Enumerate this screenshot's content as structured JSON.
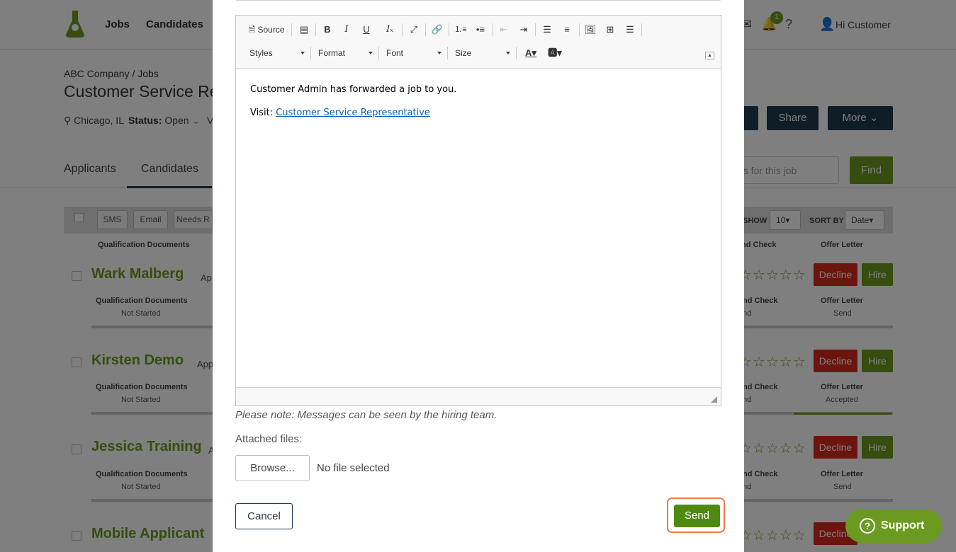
{
  "nav": {
    "jobs": "Jobs",
    "candidates": "Candidates",
    "greeting": "Hi Customer",
    "notification_count": "1"
  },
  "job": {
    "breadcrumb": "ABC Company / Jobs",
    "title": "Customer Service Re",
    "location": "Chicago, IL",
    "status_label": "Status:",
    "status_value": "Open",
    "meta_truncated": "V",
    "share_label": "Share",
    "more_label": "More"
  },
  "tabs": {
    "applicants": "Applicants",
    "candidates": "Candidates"
  },
  "search": {
    "placeholder": "es for this job",
    "find_label": "Find"
  },
  "list_toolbar": {
    "sms": "SMS",
    "email": "Email",
    "needs": "Needs R",
    "show_label": "SHOW",
    "show_value": "10",
    "sort_label": "SORT BY",
    "sort_value": "Date"
  },
  "columns": {
    "qualification": "Qualification Documents",
    "background": "nd Check",
    "offer": "Offer Letter"
  },
  "candidates": [
    {
      "name": "Wark Malberg",
      "app": "Ap",
      "qual_label": "Qualification Documents",
      "qual_value": "Not Started",
      "bg_label": "nd Check",
      "bg_value": "nd",
      "offer_label": "Offer Letter",
      "offer_value": "Send",
      "decline": "Decline",
      "hire": "Hire",
      "stars": "☆☆☆☆☆"
    },
    {
      "name": "Kirsten Demo",
      "app": "App",
      "qual_label": "Qualification Documents",
      "qual_value": "Not Started",
      "bg_label": "nd Check",
      "bg_value": "nd",
      "offer_label": "Offer Letter",
      "offer_value": "Accepted",
      "decline": "Decline",
      "hire": "Hire",
      "stars": "☆☆☆☆☆"
    },
    {
      "name": "Jessica Training",
      "app": "A",
      "qual_label": "Qualification Documents",
      "qual_value": "Not Started",
      "bg_label": "nd Check",
      "bg_value": "nd",
      "offer_label": "Offer Letter",
      "offer_value": "Send",
      "decline": "Decline",
      "hire": "Hire",
      "stars": "☆☆☆☆☆"
    },
    {
      "name": "Mobile Applicant",
      "decline": "Decline",
      "stars": "☆☆☆☆☆"
    }
  ],
  "editor": {
    "source_label": "Source",
    "styles_label": "Styles",
    "format_label": "Format",
    "font_label": "Font",
    "size_label": "Size",
    "body_line1": "Customer Admin has forwarded a job to you.",
    "body_visit": "Visit:",
    "body_link": "Customer Service Representative"
  },
  "modal": {
    "note": "Please note: Messages can be seen by the hiring team.",
    "attached_label": "Attached files:",
    "browse_label": "Browse...",
    "no_file": "No file selected",
    "cancel_label": "Cancel",
    "send_label": "Send"
  },
  "support": {
    "label": "Support"
  },
  "colors": {
    "brand_green": "#6a9a1f",
    "dark_navy": "#1f3a4d",
    "decline_red": "#d9291c",
    "highlight": "#ef7a4a"
  }
}
